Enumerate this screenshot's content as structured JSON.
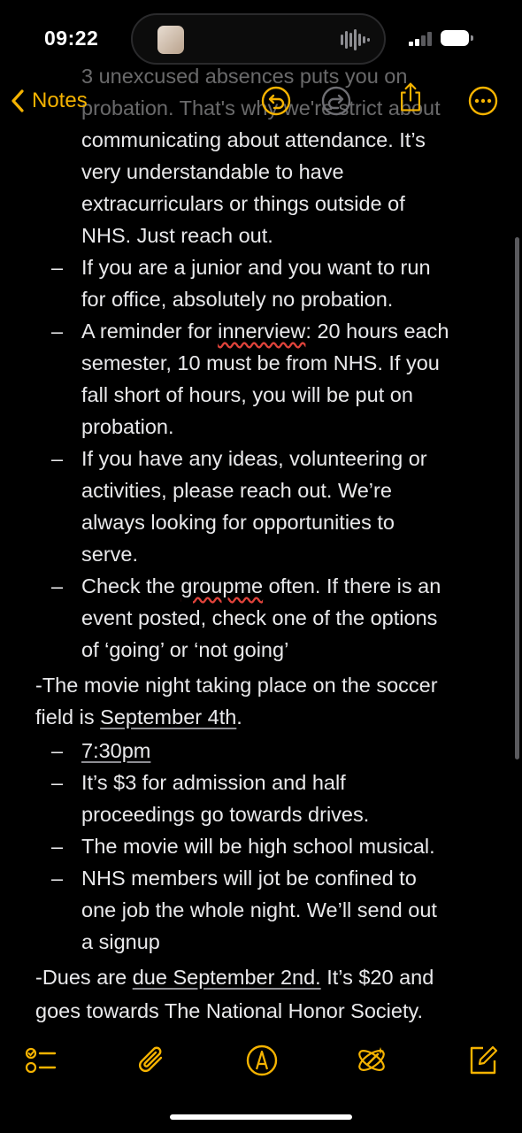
{
  "status_bar": {
    "time": "09:22"
  },
  "nav": {
    "back_label": "Notes"
  },
  "note": {
    "hidden_top_1": "3 unexcused absences puts you on",
    "hidden_top_2": "probation. That's why we're strict about",
    "lines": [
      "communicating about attendance. It’s",
      "very understandable to have",
      "extracurriculars or things outside of",
      "NHS. Just reach out."
    ],
    "bullet2_a": "If you are a junior and you want to run",
    "bullet2_b": "for office, absolutely no probation.",
    "bullet3_pre": "A reminder for ",
    "bullet3_misspell": "innerview",
    "bullet3_post": ": 20 hours each",
    "bullet3_b": "semester, 10 must be from NHS. If you",
    "bullet3_c": "fall short of hours, you will be put on",
    "bullet3_d": "probation.",
    "bullet4_a": "If you have any ideas, volunteering or",
    "bullet4_b": "activities, please reach out. We’re",
    "bullet4_c": "always looking for opportunities to",
    "bullet4_d": "serve.",
    "bullet5_pre": "Check the ",
    "bullet5_misspell": "groupme",
    "bullet5_post": " often. If there is an",
    "bullet5_b": "event posted, check one of the options",
    "bullet5_c": "of ‘going’ or ‘not going’",
    "movie_a": "-The movie night taking place on the soccer",
    "movie_b_pre": "field is ",
    "movie_b_date": "September 4th",
    "movie_b_post": ".",
    "movie_time": "7:30pm",
    "movie_bullet2_a": "It’s $3 for admission and half",
    "movie_bullet2_b": "proceedings go towards drives.",
    "movie_bullet3": "The movie will be high school musical.",
    "movie_bullet4_a": "NHS members will jot be confined to",
    "movie_bullet4_b": "one job the whole night. We’ll send out",
    "movie_bullet4_c": "a signup",
    "dues_pre": "-Dues are ",
    "dues_date": "due September 2nd.",
    "dues_post": " It’s $20 and",
    "dues_b": "goes towards The National Honor Society."
  },
  "icons": {
    "undo": "undo-icon",
    "redo": "redo-icon",
    "share": "share-icon",
    "more": "more-icon",
    "checklist": "checklist-icon",
    "attach": "paperclip-icon",
    "markup": "markup-pen-icon",
    "ai": "writing-tools-icon",
    "compose": "compose-icon"
  },
  "colors": {
    "accent": "#f5b301",
    "background": "#000000",
    "text": "#e9e9eb"
  }
}
